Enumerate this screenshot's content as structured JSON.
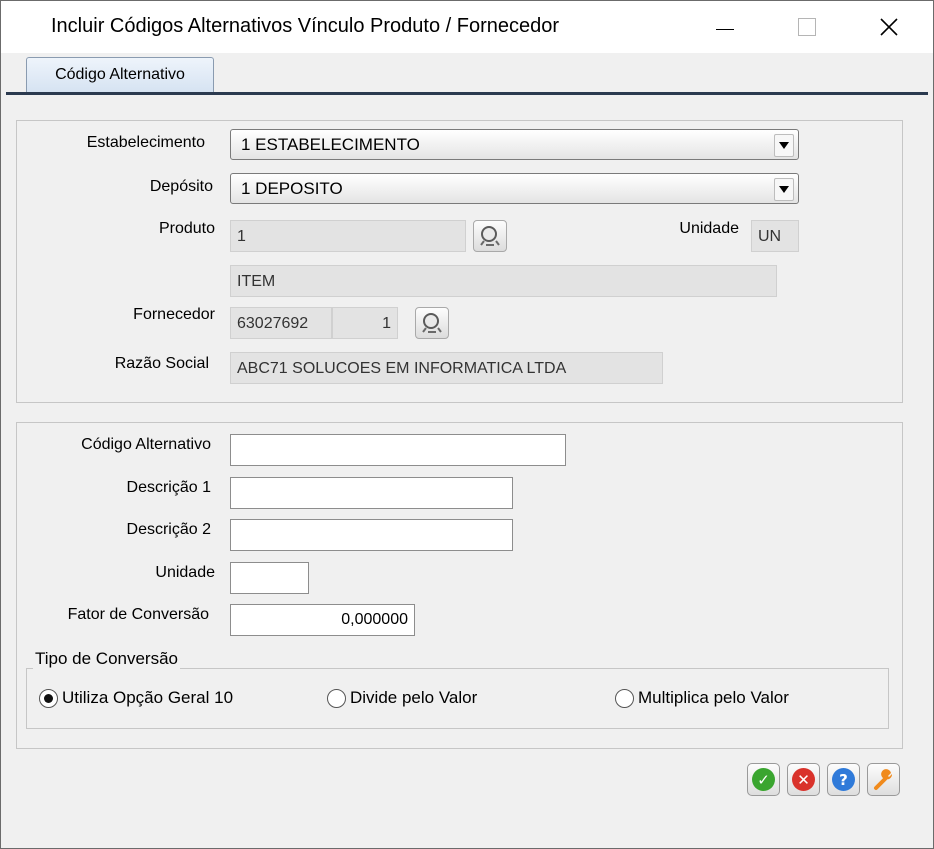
{
  "window": {
    "title": "Incluir Códigos Alternativos Vínculo Produto / Fornecedor",
    "controls": {
      "minimize": "minimize-icon",
      "maximize": "maximize-icon",
      "close": "close-icon"
    }
  },
  "tabs": [
    {
      "label": "Código Alternativo",
      "active": true
    }
  ],
  "header_section": {
    "estabelecimento": {
      "label": "Estabelecimento",
      "value": "1 ESTABELECIMENTO"
    },
    "deposito": {
      "label": "Depósito",
      "value": "1 DEPOSITO"
    },
    "produto": {
      "label": "Produto",
      "code": "1",
      "description": "ITEM"
    },
    "unidade": {
      "label": "Unidade",
      "value": "UN"
    },
    "fornecedor": {
      "label": "Fornecedor",
      "code": "63027692",
      "seq": "1"
    },
    "razao_social": {
      "label": "Razão Social",
      "value": "ABC71 SOLUCOES EM INFORMATICA LTDA"
    }
  },
  "form": {
    "codigo_alternativo": {
      "label": "Código Alternativo",
      "value": ""
    },
    "descricao1": {
      "label": "Descrição 1",
      "value": ""
    },
    "descricao2": {
      "label": "Descrição 2",
      "value": ""
    },
    "unidade": {
      "label": "Unidade",
      "value": ""
    },
    "fator_conversao": {
      "label": "Fator de Conversão",
      "value": "0,000000"
    }
  },
  "tipo_conversao": {
    "title": "Tipo de Conversão",
    "options": [
      {
        "label": "Utiliza Opção Geral 10",
        "selected": true
      },
      {
        "label": "Divide pelo Valor",
        "selected": false
      },
      {
        "label": "Multiplica pelo Valor",
        "selected": false
      }
    ]
  },
  "actions": [
    {
      "icon": "check-icon",
      "color": "#3aa52f"
    },
    {
      "icon": "cancel-icon",
      "color": "#d9322b"
    },
    {
      "icon": "help-icon",
      "color": "#2f7ad9"
    },
    {
      "icon": "wrench-icon",
      "color": "#f08a1c"
    }
  ]
}
